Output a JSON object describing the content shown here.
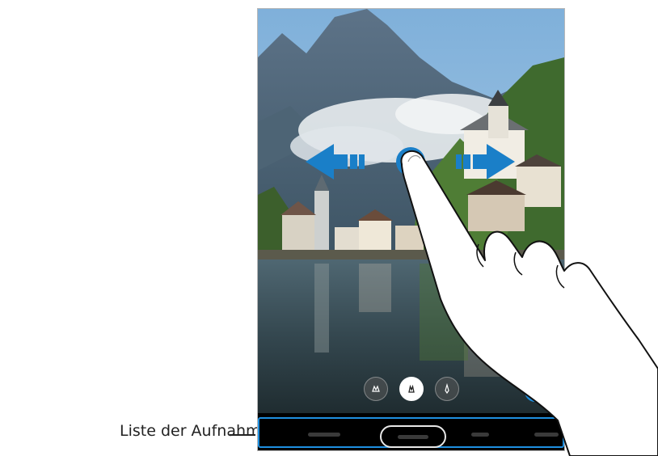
{
  "callout": {
    "label": "Liste der Aufnahmemodi"
  },
  "viewfinder": {
    "scene": "lake-village-mountain-photo"
  },
  "lens_buttons": [
    {
      "icon": "ultra-wide-lens-icon",
      "active": false
    },
    {
      "icon": "wide-lens-icon",
      "active": true
    },
    {
      "icon": "tele-lens-icon",
      "active": false
    }
  ],
  "shooting_modes": {
    "selected_index": 1
  },
  "gesture": {
    "type": "swipe-left-right",
    "arrow_color": "#1a7fc8"
  },
  "colors": {
    "highlight": "#1e8fe0",
    "arrow": "#1a7fc8"
  }
}
